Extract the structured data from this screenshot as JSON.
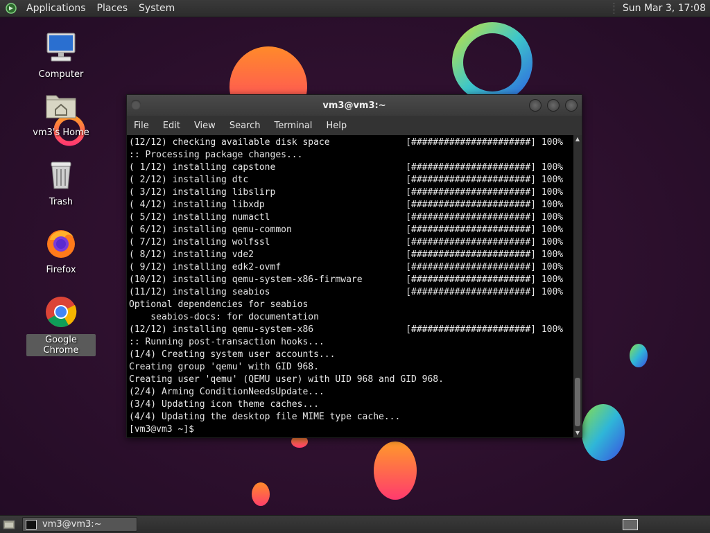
{
  "top_panel": {
    "menus": [
      "Applications",
      "Places",
      "System"
    ],
    "clock": "Sun Mar  3, 17:08"
  },
  "desktop_icons": [
    {
      "label": "Computer",
      "icon": "computer-icon"
    },
    {
      "label": "vm3's Home",
      "icon": "home-folder-icon"
    },
    {
      "label": "Trash",
      "icon": "trash-icon"
    },
    {
      "label": "Firefox",
      "icon": "firefox-icon"
    },
    {
      "label": "Google Chrome",
      "icon": "chrome-icon"
    }
  ],
  "terminal": {
    "title": "vm3@vm3:~",
    "menu": [
      "File",
      "Edit",
      "View",
      "Search",
      "Terminal",
      "Help"
    ],
    "lines": [
      "(12/12) checking available disk space              [######################] 100%",
      ":: Processing package changes...",
      "( 1/12) installing capstone                        [######################] 100%",
      "( 2/12) installing dtc                             [######################] 100%",
      "( 3/12) installing libslirp                        [######################] 100%",
      "( 4/12) installing libxdp                          [######################] 100%",
      "( 5/12) installing numactl                         [######################] 100%",
      "( 6/12) installing qemu-common                     [######################] 100%",
      "( 7/12) installing wolfssl                         [######################] 100%",
      "( 8/12) installing vde2                            [######################] 100%",
      "( 9/12) installing edk2-ovmf                       [######################] 100%",
      "(10/12) installing qemu-system-x86-firmware        [######################] 100%",
      "(11/12) installing seabios                         [######################] 100%",
      "Optional dependencies for seabios",
      "    seabios-docs: for documentation",
      "(12/12) installing qemu-system-x86                 [######################] 100%",
      ":: Running post-transaction hooks...",
      "(1/4) Creating system user accounts...",
      "Creating group 'qemu' with GID 968.",
      "Creating user 'qemu' (QEMU user) with UID 968 and GID 968.",
      "(2/4) Arming ConditionNeedsUpdate...",
      "(3/4) Updating icon theme caches...",
      "(4/4) Updating the desktop file MIME type cache...",
      "[vm3@vm3 ~]$ "
    ]
  },
  "taskbar": {
    "items": [
      {
        "label": "vm3@vm3:~",
        "icon": "terminal-icon"
      }
    ]
  }
}
